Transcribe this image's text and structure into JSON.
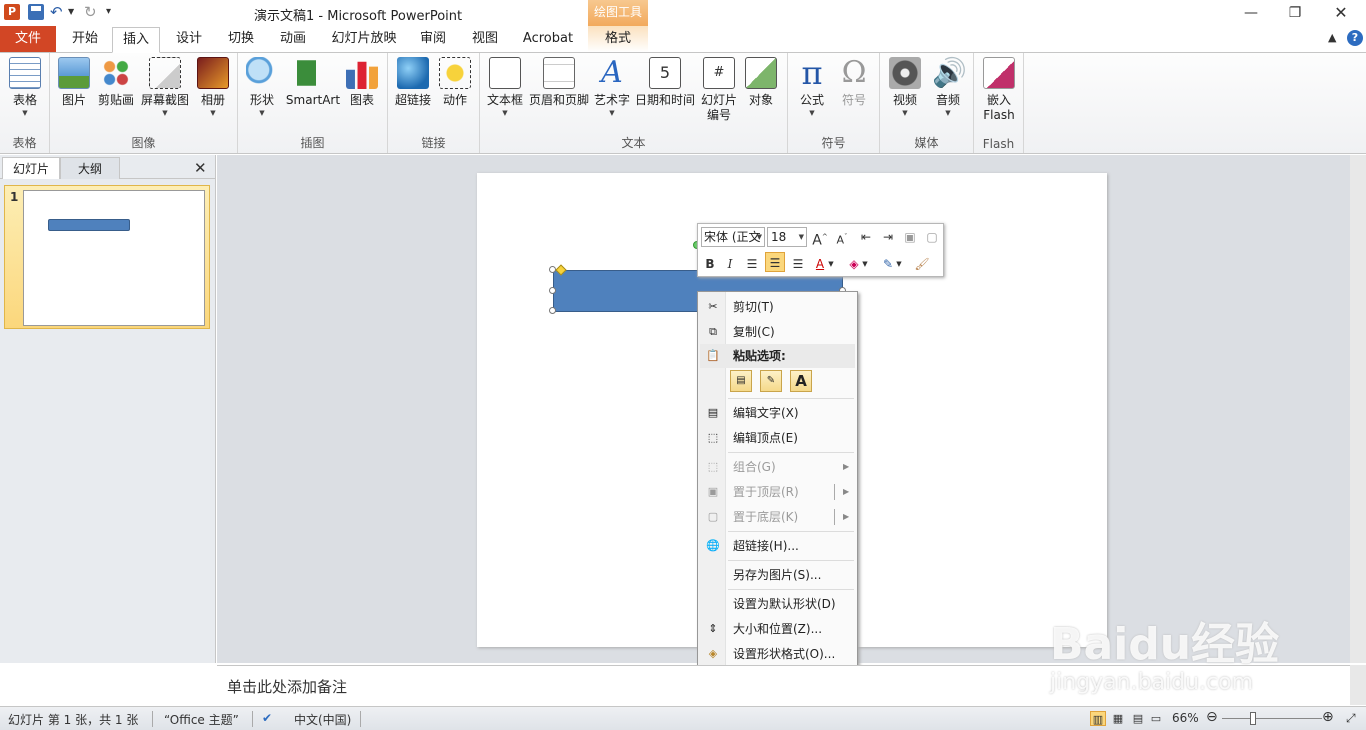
{
  "titlebar": {
    "app_logo": "P",
    "title": "演示文稿1  -  Microsoft PowerPoint",
    "contextual_header": "绘图工具"
  },
  "tabs": {
    "file": "文件",
    "items": [
      "开始",
      "插入",
      "设计",
      "切换",
      "动画",
      "幻灯片放映",
      "审阅",
      "视图",
      "Acrobat",
      "格式"
    ],
    "active": "插入"
  },
  "ribbon": {
    "groups": {
      "tables": "表格",
      "images": "图像",
      "illustrations": "插图",
      "links": "链接",
      "text": "文本",
      "symbols": "符号",
      "media": "媒体",
      "flash": "Flash"
    },
    "buttons": {
      "table": "表格",
      "picture": "图片",
      "clipart": "剪贴画",
      "screenshot": "屏幕截图",
      "album": "相册",
      "shapes": "形状",
      "smartart": "SmartArt",
      "chart": "图表",
      "hyperlink": "超链接",
      "action": "动作",
      "textbox": "文本框",
      "header_footer": "页眉和页脚",
      "wordart": "艺术字",
      "datetime": "日期和时间",
      "slidenum_1": "幻灯片",
      "slidenum_2": "编号",
      "object": "对象",
      "equation": "公式",
      "symbol": "符号",
      "video": "视频",
      "audio": "音频",
      "embed_1": "嵌入",
      "embed_2": "Flash"
    },
    "glyphs": {
      "wordart": "A",
      "datetime": "5",
      "slidenum": "#",
      "equation": "π",
      "symbol": "Ω",
      "audio": "🔊"
    }
  },
  "left_panel": {
    "tab_slides": "幻灯片",
    "tab_outline": "大纲",
    "slide_number": "1"
  },
  "mini_toolbar": {
    "font_name": "宋体 (正文",
    "font_size": "18"
  },
  "context_menu": {
    "items": {
      "cut": "剪切(T)",
      "copy": "复制(C)",
      "paste_options": "粘贴选项:",
      "edit_text": "编辑文字(X)",
      "edit_points": "编辑顶点(E)",
      "group": "组合(G)",
      "bring_front": "置于顶层(R)",
      "send_back": "置于底层(K)",
      "hyperlink": "超链接(H)...",
      "save_as_picture": "另存为图片(S)...",
      "set_default_shape": "设置为默认形状(D)",
      "size_position": "大小和位置(Z)...",
      "format_shape": "设置形状格式(O)..."
    }
  },
  "notes": {
    "placeholder": "单击此处添加备注"
  },
  "statusbar": {
    "slide_info": "幻灯片 第 1 张，共 1 张",
    "theme": "“Office 主题”",
    "language": "中文(中国)",
    "zoom": "66%"
  },
  "watermark": {
    "logo": "Baidu经验",
    "url": "jingyan.baidu.com"
  }
}
